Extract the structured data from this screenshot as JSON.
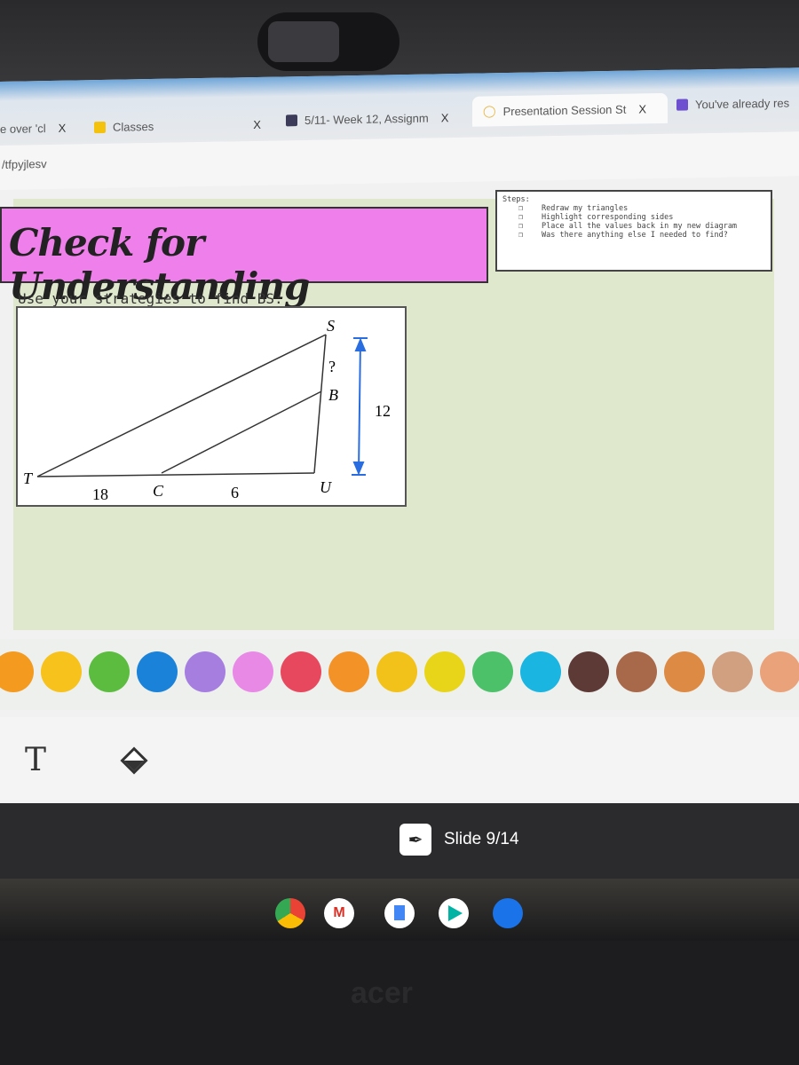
{
  "browser": {
    "tabs": [
      {
        "label": "e over 'cl",
        "close": "X"
      },
      {
        "label": "Classes",
        "close": "X",
        "icon": "google-classroom-icon",
        "color": "#f4c20d"
      },
      {
        "label": "5/11- Week 12, Assignm",
        "close": "X",
        "icon": "classroom-assignment-icon",
        "color": "#3c3c5a"
      },
      {
        "label": "Presentation Session St",
        "close": "X",
        "icon": "peardeck-icon",
        "color": "#e8b33c",
        "active": true
      },
      {
        "label": "You've already res",
        "icon": "google-forms-icon",
        "color": "#6d4fd0"
      }
    ],
    "address": "/tfpyjlesv"
  },
  "slide": {
    "title": "Check for Understanding",
    "title_bg": "#ef7fea",
    "steps_heading": "Steps:",
    "steps": [
      "Redraw my triangles",
      "Highlight corresponding sides",
      "Place all the values back in my new diagram",
      "Was there anything else I needed to find?"
    ],
    "prompt": "Use your strategies to find BS:",
    "diagram": {
      "S": "S",
      "T": "T",
      "U": "U",
      "B": "B",
      "C": "C",
      "q": "?",
      "tc": "18",
      "cu": "6",
      "su": "12"
    }
  },
  "palette": [
    "#f39a1f",
    "#f7c21b",
    "#5cbc3f",
    "#1a82d8",
    "#a67ee0",
    "#e889e6",
    "#e8485e",
    "#f39227",
    "#f2c21a",
    "#e8d51a",
    "#4cc16a",
    "#1ab5e0",
    "#5e3a36",
    "#a8684a",
    "#dd8b44",
    "#d1a080",
    "#eaa27a"
  ],
  "tools": {
    "text_icon": "T",
    "eraser": "eraser-icon"
  },
  "shelf": {
    "slide_label": "Slide 9/14"
  },
  "taskbar": [
    "chrome",
    "gmail",
    "docs",
    "play-store",
    "files"
  ],
  "brand": "acer"
}
